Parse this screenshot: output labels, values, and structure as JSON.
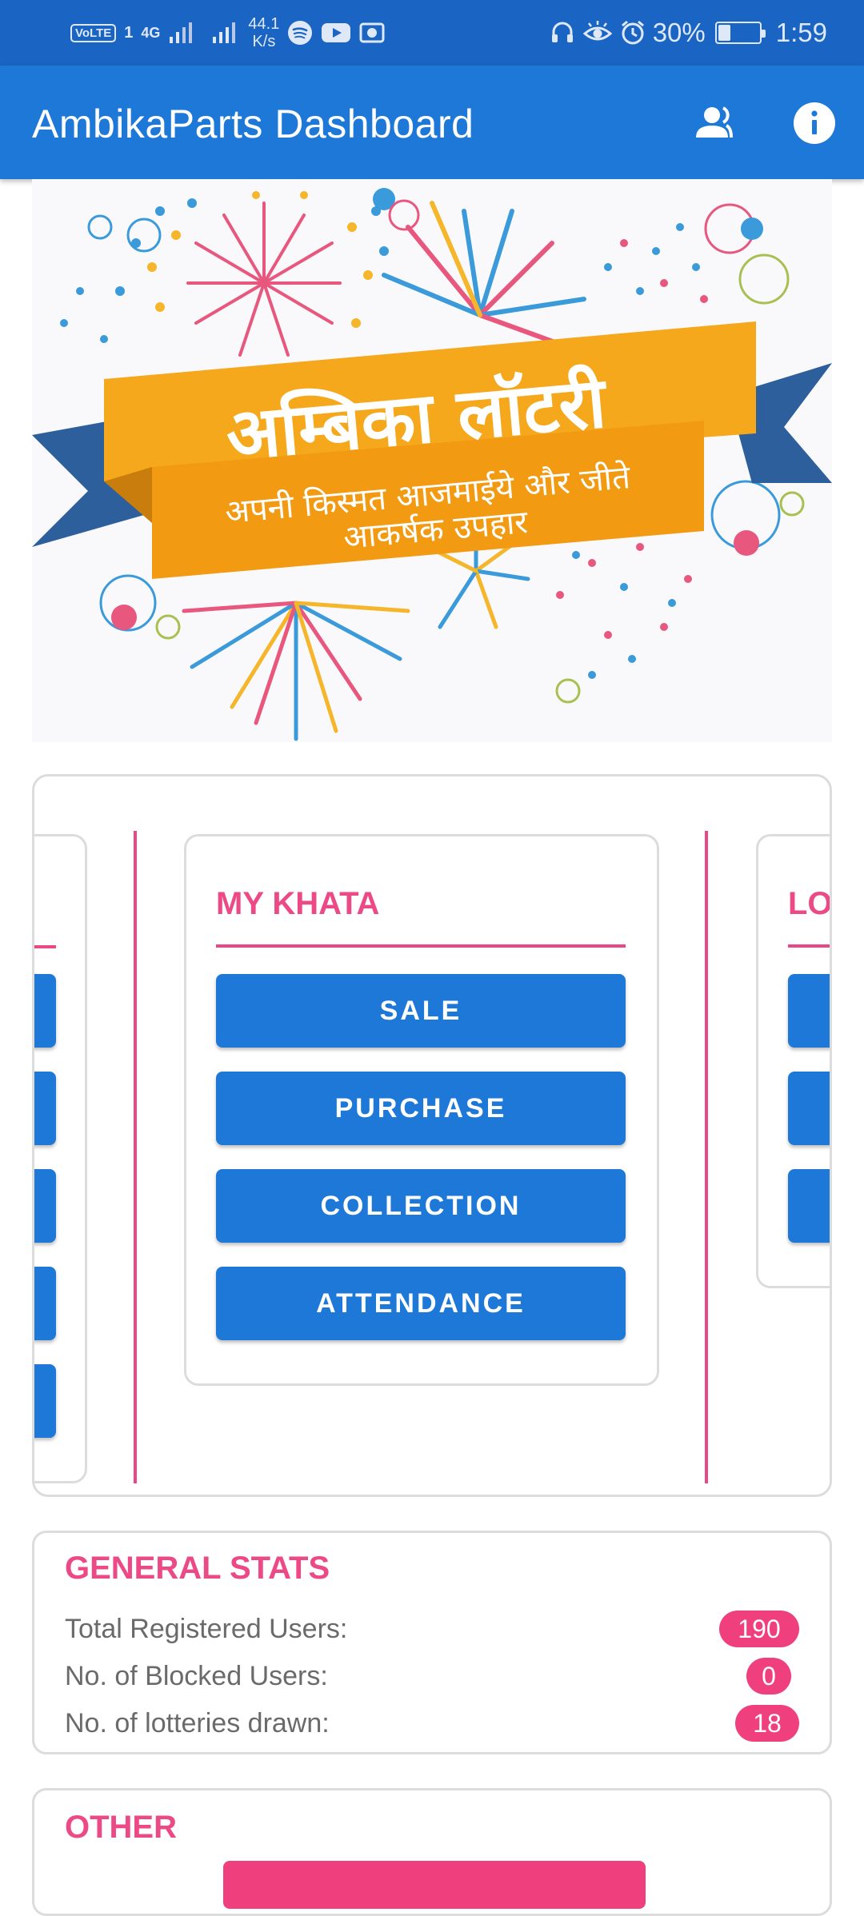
{
  "status_bar": {
    "volte": "VoLTE",
    "sim": "1",
    "network": "4G",
    "speed_value": "44.1",
    "speed_unit": "K/s",
    "battery": "30%",
    "time": "1:59",
    "battery_level": 0.3,
    "icons": [
      "signal-icon",
      "spotify-icon",
      "youtube-icon",
      "screenshot-icon",
      "headset-icon",
      "eye-comfort-icon",
      "alarm-icon",
      "battery-icon"
    ]
  },
  "app_bar": {
    "title": "AmbikaParts Dashboard",
    "icons": [
      "users-icon",
      "info-icon"
    ]
  },
  "banner": {
    "title": "अम्बिका लॉटरी",
    "subtitle_line1": "अपनी किस्मत आजमाईये और जीते",
    "subtitle_line2": "आकर्षक उपहार"
  },
  "khata_card": {
    "title": "MY KHATA",
    "buttons": [
      "SALE",
      "PURCHASE",
      "COLLECTION",
      "ATTENDANCE"
    ]
  },
  "next_card": {
    "title_partial": "LOT"
  },
  "general_stats": {
    "title": "GENERAL STATS",
    "rows": [
      {
        "label": "Total Registered Users:",
        "value": "190"
      },
      {
        "label": "No. of Blocked Users:",
        "value": "0"
      },
      {
        "label": "No. of lotteries drawn:",
        "value": "18"
      }
    ]
  },
  "other": {
    "title": "OTHER"
  },
  "colors": {
    "status_bar": "#1a64c4",
    "app_bar": "#1e78d8",
    "accent_pink": "#ec4a86",
    "button_blue": "#1e78d8",
    "ribbon_orange": "#f6a81c",
    "ribbon_blue": "#2c5f9c"
  }
}
